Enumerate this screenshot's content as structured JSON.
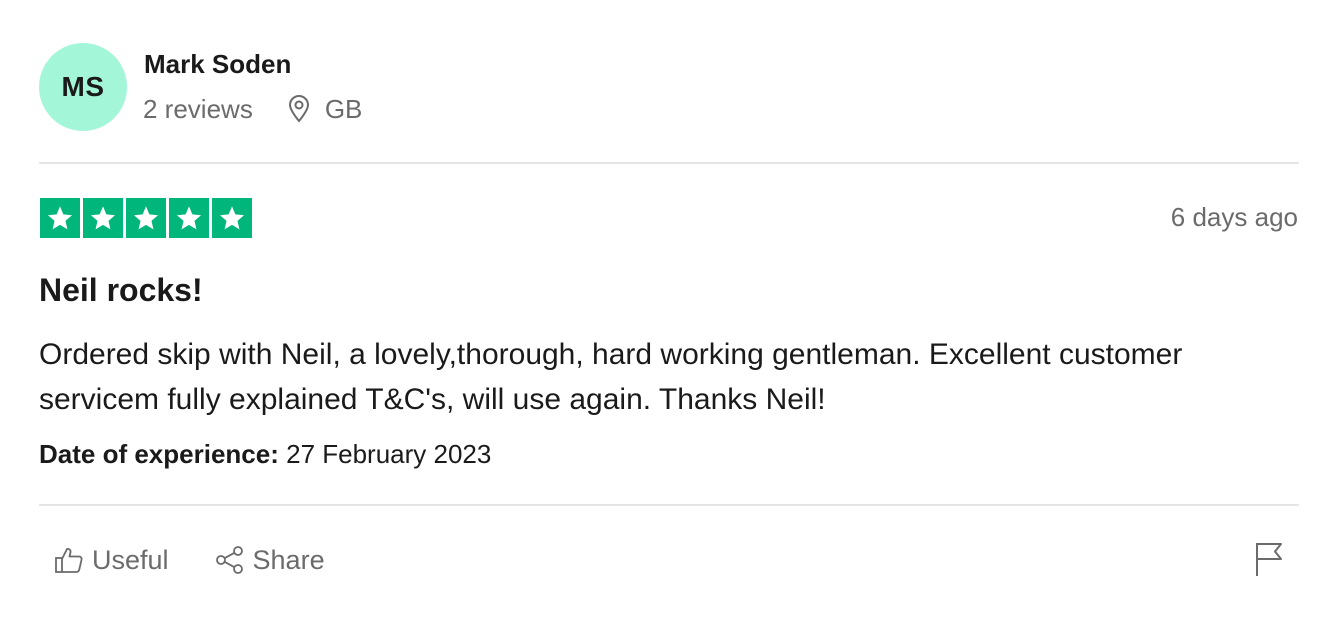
{
  "reviewer": {
    "initials": "MS",
    "name": "Mark Soden",
    "reviews_count": "2 reviews",
    "location": "GB",
    "avatar_color": "#a3f7d8"
  },
  "review": {
    "rating": 5,
    "rating_max": 5,
    "star_color": "#00b67a",
    "posted": "6 days ago",
    "title": "Neil rocks!",
    "body": "Ordered skip with Neil, a lovely,thorough, hard working gentleman. Excellent customer servicem fully explained T&C's, will use again. Thanks Neil!",
    "experience_label": "Date of experience:",
    "experience_date": "27 February 2023"
  },
  "actions": {
    "useful_label": "Useful",
    "share_label": "Share",
    "icons": [
      "thumbs-up-icon",
      "share-icon",
      "flag-icon",
      "location-pin-icon",
      "star-icon"
    ]
  }
}
